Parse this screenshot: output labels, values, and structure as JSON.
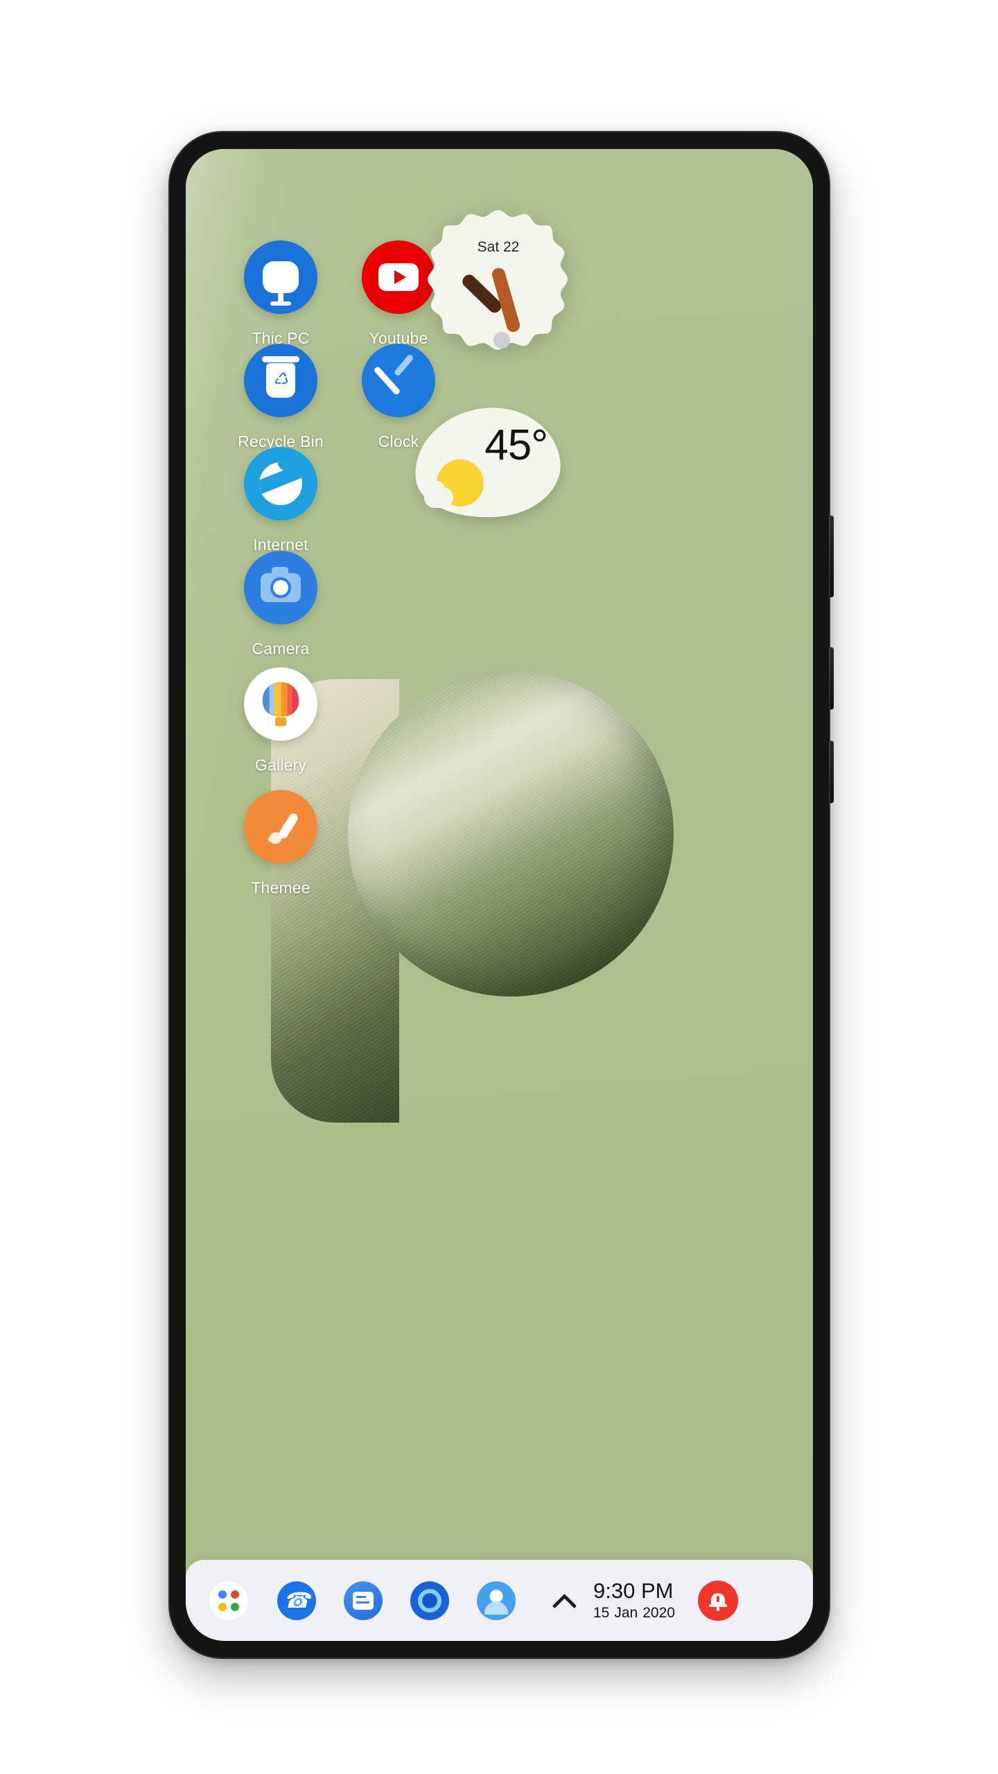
{
  "device": {
    "frame_color": "#141414",
    "wallpaper_color": "#aebf8f"
  },
  "apps": [
    {
      "id": "thic-pc",
      "label": "Thic PC",
      "icon": "monitor-icon",
      "bg": "#1a73d9"
    },
    {
      "id": "youtube",
      "label": "Youtube",
      "icon": "youtube-icon",
      "bg": "#eb0000"
    },
    {
      "id": "recycle-bin",
      "label": "Recycle Bin",
      "icon": "trash-icon",
      "bg": "#1a73d9"
    },
    {
      "id": "clock",
      "label": "Clock",
      "icon": "clock-icon",
      "bg": "#1f7ae0"
    },
    {
      "id": "internet",
      "label": "Internet",
      "icon": "edge-icon",
      "bg": "#1ea0e0"
    },
    {
      "id": "camera",
      "label": "Camera",
      "icon": "camera-icon",
      "bg": "#2a7fe0"
    },
    {
      "id": "gallery",
      "label": "Gallery",
      "icon": "balloon-icon",
      "bg": "#ffffff"
    },
    {
      "id": "themee",
      "label": "Themee",
      "icon": "paintbrush-icon",
      "bg": "#f28a37"
    }
  ],
  "widgets": {
    "clock": {
      "date": "Sat 22",
      "hand_hour_color": "#4a2a16",
      "hand_minute_color": "#b35b22",
      "face_color": "#f4f5ed"
    },
    "weather": {
      "temperature": "45°",
      "condition_icon": "sun-behind-cloud-icon",
      "sun_color": "#f8d530",
      "card_color": "#f4f5ed"
    }
  },
  "taskbar": {
    "background": "#eff0f5",
    "items": [
      {
        "id": "start",
        "icon": "windows-start-icon"
      },
      {
        "id": "phone",
        "icon": "phone-icon"
      },
      {
        "id": "messages",
        "icon": "messages-icon"
      },
      {
        "id": "cortana",
        "icon": "cortana-icon"
      },
      {
        "id": "people",
        "icon": "people-icon"
      }
    ],
    "chevron": "chevron-up-icon",
    "time": "9:30 PM",
    "date_day": "15",
    "date_month": "Jan",
    "date_year": "2020",
    "notification": {
      "icon": "bell-icon",
      "color": "#f1352a"
    }
  }
}
